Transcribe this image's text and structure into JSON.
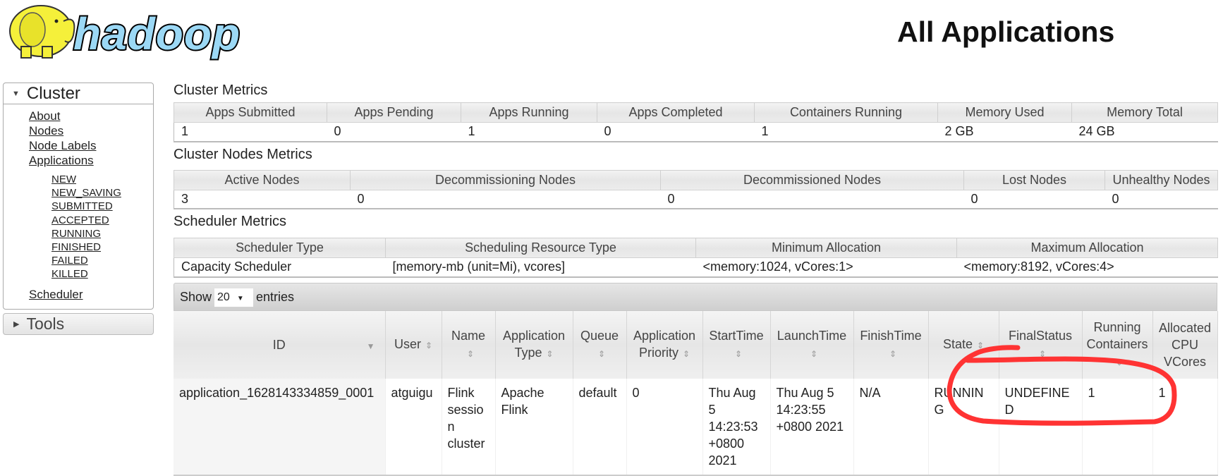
{
  "logo": {
    "text": "hadoop",
    "colors": {
      "elephant": "#f5f03a",
      "text": "#9bd8f5"
    }
  },
  "page_title": "All Applications",
  "sidebar": {
    "cluster_label": "Cluster",
    "links": [
      "About",
      "Nodes",
      "Node Labels",
      "Applications"
    ],
    "app_states": [
      "NEW",
      "NEW_SAVING",
      "SUBMITTED",
      "ACCEPTED",
      "RUNNING",
      "FINISHED",
      "FAILED",
      "KILLED"
    ],
    "scheduler": "Scheduler",
    "tools_label": "Tools"
  },
  "cluster_metrics": {
    "title": "Cluster Metrics",
    "headers": [
      "Apps Submitted",
      "Apps Pending",
      "Apps Running",
      "Apps Completed",
      "Containers Running",
      "Memory Used",
      "Memory Total"
    ],
    "values": [
      "1",
      "0",
      "1",
      "0",
      "1",
      "2 GB",
      "24 GB"
    ]
  },
  "nodes_metrics": {
    "title": "Cluster Nodes Metrics",
    "headers": [
      "Active Nodes",
      "Decommissioning Nodes",
      "Decommissioned Nodes",
      "Lost Nodes",
      "Unhealthy Nodes"
    ],
    "values": [
      "3",
      "0",
      "0",
      "0",
      "0"
    ]
  },
  "scheduler_metrics": {
    "title": "Scheduler Metrics",
    "headers": [
      "Scheduler Type",
      "Scheduling Resource Type",
      "Minimum Allocation",
      "Maximum Allocation"
    ],
    "values": [
      "Capacity Scheduler",
      "[memory-mb (unit=Mi), vcores]",
      "<memory:1024, vCores:1>",
      "<memory:8192, vCores:4>"
    ]
  },
  "apps_table": {
    "show_label": "Show",
    "entries_label": "entries",
    "page_size": "20",
    "headers": [
      "ID",
      "User",
      "Name",
      "Application Type",
      "Queue",
      "Application Priority",
      "StartTime",
      "LaunchTime",
      "FinishTime",
      "State",
      "FinalStatus",
      "Running Containers",
      "Allocated CPU VCores"
    ],
    "rows": [
      [
        "application_1628143334859_0001",
        "atguigu",
        "Flink session cluster",
        "Apache Flink",
        "default",
        "0",
        "Thu Aug 5 14:23:53 +0800 2021",
        "Thu Aug 5 14:23:55 +0800 2021",
        "N/A",
        "RUNNING",
        "UNDEFINED",
        "1",
        "1"
      ]
    ]
  },
  "annotation": {
    "color": "#ff3333"
  }
}
